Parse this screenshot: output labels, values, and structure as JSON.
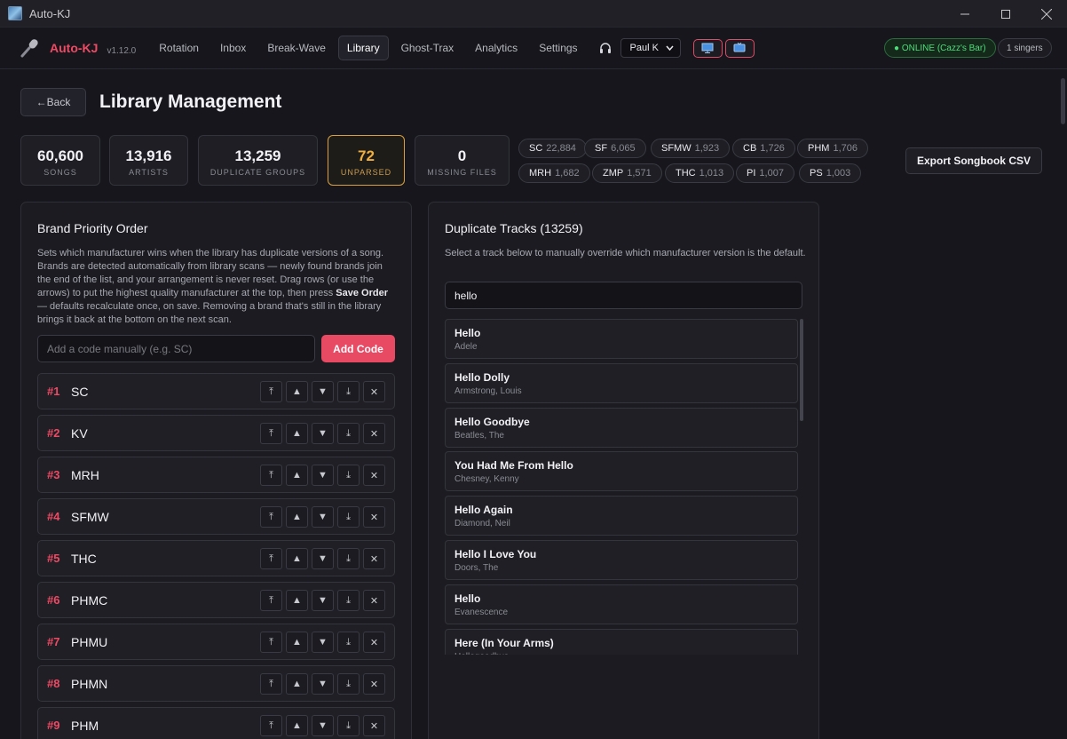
{
  "window": {
    "title": "Auto-KJ"
  },
  "app": {
    "name": "Auto-KJ",
    "version": "v1.12.0"
  },
  "nav": {
    "tabs": [
      {
        "label": "Rotation",
        "active": false
      },
      {
        "label": "Inbox",
        "active": false
      },
      {
        "label": "Break-Wave",
        "active": false
      },
      {
        "label": "Library",
        "active": true
      },
      {
        "label": "Ghost-Trax",
        "active": false
      },
      {
        "label": "Analytics",
        "active": false
      },
      {
        "label": "Settings",
        "active": false
      }
    ],
    "user_selected": "Paul K",
    "status": "● ONLINE (Cazz's Bar)",
    "singers": "1 singers"
  },
  "page": {
    "back_label": "←Back",
    "title": "Library Management"
  },
  "stats": [
    {
      "value": "60,600",
      "label": "SONGS"
    },
    {
      "value": "13,916",
      "label": "ARTISTS"
    },
    {
      "value": "13,259",
      "label": "DUPLICATE GROUPS"
    },
    {
      "value": "72",
      "label": "UNPARSED"
    },
    {
      "value": "0",
      "label": "MISSING FILES"
    }
  ],
  "brand_counts": [
    {
      "code": "SC",
      "count": "22,884"
    },
    {
      "code": "SF",
      "count": "6,065"
    },
    {
      "code": "SFMW",
      "count": "1,923"
    },
    {
      "code": "CB",
      "count": "1,726"
    },
    {
      "code": "PHM",
      "count": "1,706"
    },
    {
      "code": "MRH",
      "count": "1,682"
    },
    {
      "code": "ZMP",
      "count": "1,571"
    },
    {
      "code": "THC",
      "count": "1,013"
    },
    {
      "code": "PI",
      "count": "1,007"
    },
    {
      "code": "PS",
      "count": "1,003"
    }
  ],
  "export_label": "Export Songbook CSV",
  "priority": {
    "title": "Brand Priority Order",
    "desc_1": "Sets which manufacturer wins when the library has duplicate versions of a song. Brands are detected automatically from library scans — newly found brands join the end of the list, and your arrangement is never reset. Drag rows (or use the arrows) to put the highest quality manufacturer at the top, then press ",
    "desc_bold": "Save Order",
    "desc_2": " — defaults recalculate once, on save. Removing a brand that's still in the library brings it back at the bottom on the next scan.",
    "input_placeholder": "Add a code manually (e.g. SC)",
    "add_label": "Add Code",
    "rows": [
      {
        "rank": "#1",
        "code": "SC"
      },
      {
        "rank": "#2",
        "code": "KV"
      },
      {
        "rank": "#3",
        "code": "MRH"
      },
      {
        "rank": "#4",
        "code": "SFMW"
      },
      {
        "rank": "#5",
        "code": "THC"
      },
      {
        "rank": "#6",
        "code": "PHMC"
      },
      {
        "rank": "#7",
        "code": "PHMU"
      },
      {
        "rank": "#8",
        "code": "PHMN"
      },
      {
        "rank": "#9",
        "code": "PHM"
      }
    ],
    "ctrl_glyphs": {
      "top": "⤒",
      "up": "▲",
      "down": "▼",
      "bottom": "⤓",
      "remove": "✕"
    }
  },
  "duplicates": {
    "title": "Duplicate Tracks (13259)",
    "desc": "Select a track below to manually override which manufacturer version is the default.",
    "search_value": "hello",
    "tracks": [
      {
        "title": "Hello",
        "artist": "Adele"
      },
      {
        "title": "Hello Dolly",
        "artist": "Armstrong, Louis"
      },
      {
        "title": "Hello Goodbye",
        "artist": "Beatles, The"
      },
      {
        "title": "You Had Me From Hello",
        "artist": "Chesney, Kenny"
      },
      {
        "title": "Hello Again",
        "artist": "Diamond, Neil"
      },
      {
        "title": "Hello I Love You",
        "artist": "Doors, The"
      },
      {
        "title": "Hello",
        "artist": "Evanescence"
      },
      {
        "title": "Here (In Your Arms)",
        "artist": "Hellogoodbye"
      }
    ]
  },
  "colors": {
    "accent": "#ef4a64",
    "warn": "#f0b040",
    "online": "#4fdc7a"
  },
  "icons": [
    "app-icon",
    "mic-icon",
    "headphone-icon",
    "monitor-icon",
    "tv-icon"
  ]
}
